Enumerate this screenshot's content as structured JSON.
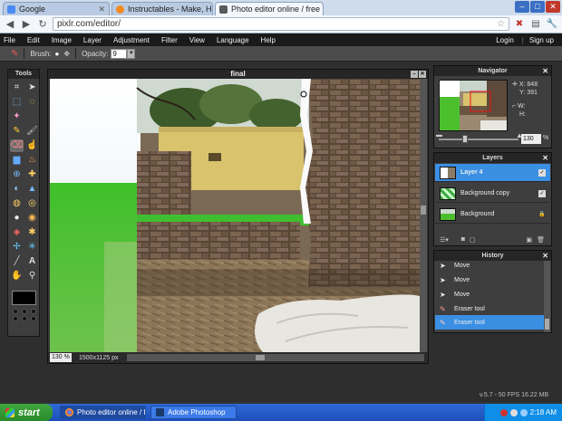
{
  "browser": {
    "tabs": [
      {
        "label": "Google",
        "color": "#4a8af4"
      },
      {
        "label": "Instructables - Make, How To",
        "color": "#f28a1e"
      },
      {
        "label": "Photo editor online / free ima",
        "color": "#5a5a5a"
      }
    ],
    "url": "pixlr.com/editor/"
  },
  "menu": {
    "items": [
      "File",
      "Edit",
      "Image",
      "Layer",
      "Adjustment",
      "Filter",
      "View",
      "Language",
      "Help"
    ],
    "login": "Login",
    "signup": "Sign up"
  },
  "options": {
    "brush_label": "Brush:",
    "opacity_label": "Opacity:",
    "opacity_value": "9"
  },
  "tools": {
    "title": "Tools"
  },
  "canvas": {
    "title": "final",
    "zoom": "130 %",
    "dimensions": "1500x1125 px"
  },
  "navigator": {
    "title": "Navigator",
    "x_label": "X:",
    "x_value": "848",
    "y_label": "Y:",
    "y_value": "391",
    "w_label": "W:",
    "h_label": "H:",
    "zoom": "130",
    "pct": "%"
  },
  "layers": {
    "title": "Layers",
    "items": [
      "Layer 4",
      "Background copy",
      "Background"
    ]
  },
  "history": {
    "title": "History",
    "items": [
      "Move",
      "Move",
      "Move",
      "Eraser tool",
      "Eraser tool"
    ]
  },
  "status": {
    "fps": "v.5.7 - 50 FPS 16.22 MB"
  },
  "taskbar": {
    "start": "start",
    "tasks": [
      "Photo editor online / f...",
      "Adobe Photoshop"
    ],
    "clock": "2:18 AM"
  }
}
